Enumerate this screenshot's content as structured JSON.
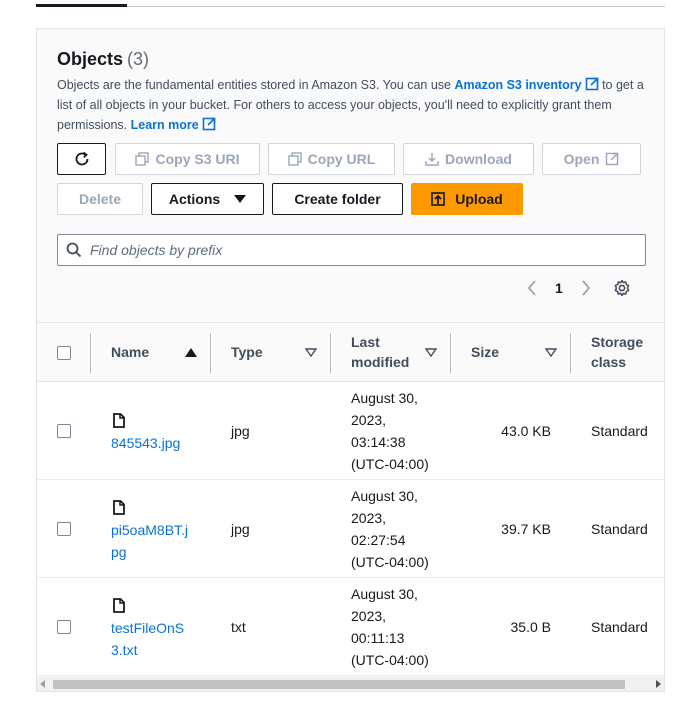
{
  "panel": {
    "title": "Objects",
    "count": "(3)",
    "description": {
      "part1": "Objects are the fundamental entities stored in Amazon S3. You can use ",
      "inventory_link": "Amazon S3 inventory",
      "part2": " to get a list of all objects in your bucket. For others to access your objects, you'll need to explicitly grant them permissions. ",
      "learn_more": "Learn more"
    }
  },
  "toolbar": {
    "refresh_label": "",
    "copy_s3_uri": "Copy S3 URI",
    "copy_url": "Copy URL",
    "download": "Download",
    "open": "Open",
    "delete": "Delete",
    "actions": "Actions",
    "create_folder": "Create folder",
    "upload": "Upload"
  },
  "search": {
    "placeholder": "Find objects by prefix",
    "value": ""
  },
  "pagination": {
    "current_page": "1"
  },
  "table": {
    "headers": {
      "name": "Name",
      "type": "Type",
      "last_modified": "Last modified",
      "size": "Size",
      "storage_class": "Storage class"
    },
    "rows": [
      {
        "name": "845543.jpg",
        "type": "jpg",
        "modified_line1": "August 30,",
        "modified_line2": "2023,",
        "modified_line3": "03:14:38",
        "modified_line4": "(UTC-04:00)",
        "size": "43.0 KB",
        "storage_class": "Standard"
      },
      {
        "name": "pi5oaM8BT.jpg",
        "type": "jpg",
        "modified_line1": "August 30,",
        "modified_line2": "2023,",
        "modified_line3": "02:27:54",
        "modified_line4": "(UTC-04:00)",
        "size": "39.7 KB",
        "storage_class": "Standard"
      },
      {
        "name": "testFileOnS3.txt",
        "type": "txt",
        "modified_line1": "August 30,",
        "modified_line2": "2023,",
        "modified_line3": "00:11:13",
        "modified_line4": "(UTC-04:00)",
        "size": "35.0 B",
        "storage_class": "Standard"
      }
    ]
  },
  "colors": {
    "link": "#0972d3",
    "primary_button": "#ff9900",
    "text": "#16191f",
    "disabled_text": "#9ba7b6"
  },
  "icons": {
    "refresh": "refresh-icon",
    "copy": "copy-icon",
    "download": "download-icon",
    "external": "external-link-icon",
    "caret": "caret-down-icon",
    "upload": "upload-icon",
    "search": "search-icon",
    "settings": "gear-icon",
    "file": "file-icon"
  }
}
